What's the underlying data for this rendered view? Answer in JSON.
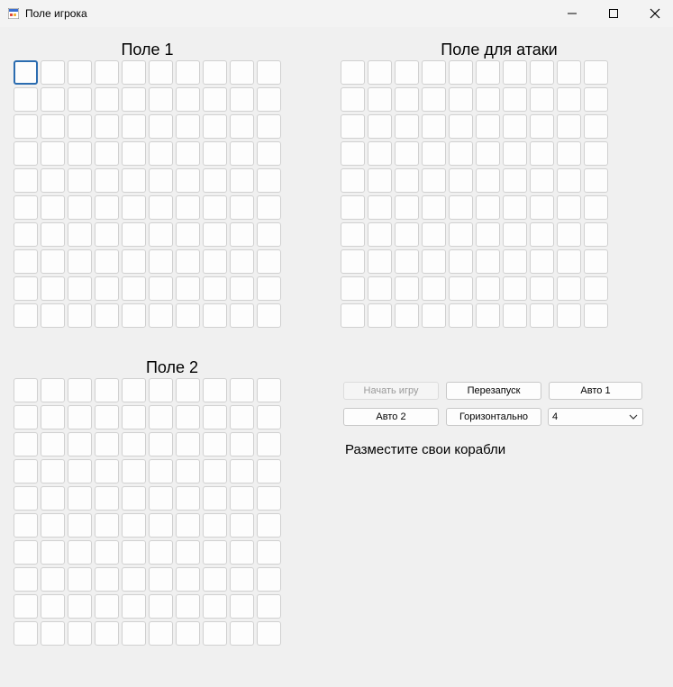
{
  "window": {
    "title": "Поле игрока",
    "icon": "app-icon"
  },
  "fields": {
    "field1": {
      "title": "Поле 1",
      "rows": 10,
      "cols": 10
    },
    "attack": {
      "title": "Поле для атаки",
      "rows": 10,
      "cols": 10
    },
    "field2": {
      "title": "Поле 2",
      "rows": 10,
      "cols": 10
    }
  },
  "controls": {
    "start_label": "Начать игру",
    "restart_label": "Перезапуск",
    "auto1_label": "Авто 1",
    "auto2_label": "Авто 2",
    "orientation_label": "Горизонтально",
    "ship_size_value": "4"
  },
  "status_text": "Разместите свои корабли",
  "colors": {
    "focus": "#2b6cb0",
    "background": "#f0f0f0",
    "cell_border": "#d0d0d0"
  }
}
